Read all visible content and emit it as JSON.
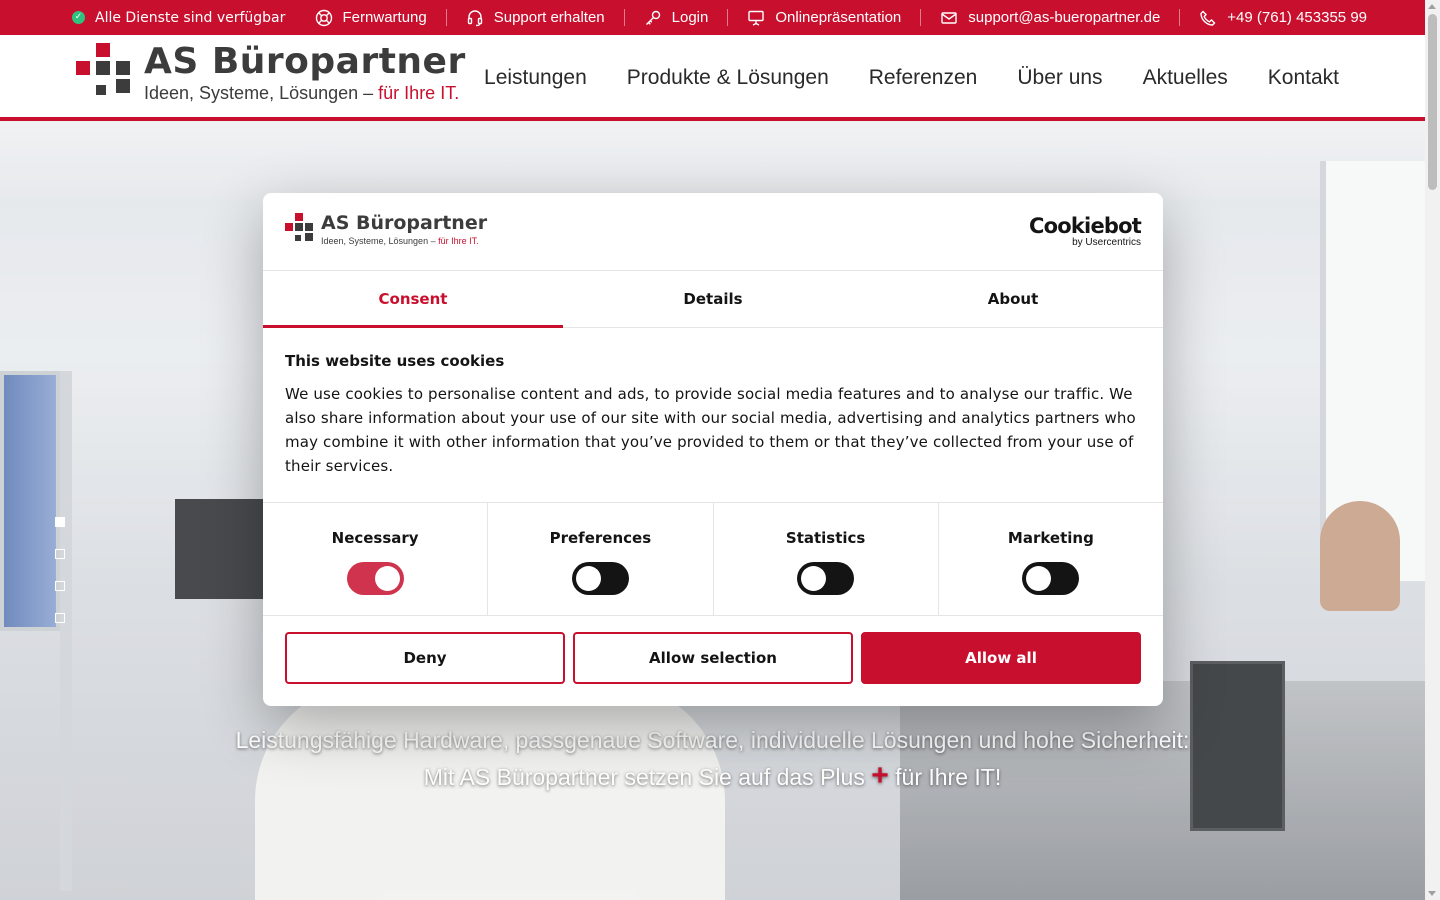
{
  "topbar": {
    "status_text": "Alle Dienste sind verfügbar",
    "links": [
      {
        "label": "Fernwartung",
        "icon": "lifebuoy-icon"
      },
      {
        "label": "Support erhalten",
        "icon": "headset-icon"
      },
      {
        "label": "Login",
        "icon": "key-icon"
      },
      {
        "label": "Onlinepräsentation",
        "icon": "presentation-icon"
      },
      {
        "label": "support@as-bueropartner.de",
        "icon": "envelope-icon"
      },
      {
        "label": "+49 (761) 453355 99",
        "icon": "phone-icon"
      }
    ]
  },
  "header": {
    "logo_name": "AS Büropartner",
    "logo_tagline": "Ideen, Systeme, Lösungen – ",
    "logo_tagline_accent": "für Ihre IT.",
    "nav": [
      "Leistungen",
      "Produkte & Lösungen",
      "Referenzen",
      "Über uns",
      "Aktuelles",
      "Kontakt"
    ]
  },
  "hero": {
    "line1": "Leistungsfähige Hardware, passgenaue Software, individuelle Lösungen und hohe Sicherheit:",
    "line2_a": "Mit AS Büropartner setzen Sie auf das Plus ",
    "line2_plus": "+",
    "line2_b": " für Ihre IT!",
    "slides_count": 4,
    "active_slide": 1
  },
  "cookie_dialog": {
    "logo_name": "AS Büropartner",
    "logo_tagline": "Ideen, Systeme, Lösungen – ",
    "logo_tagline_accent": "für Ihre IT.",
    "provider": "Cookiebot",
    "provider_sub": "by Usercentrics",
    "tabs": [
      "Consent",
      "Details",
      "About"
    ],
    "active_tab": "Consent",
    "heading": "This website uses cookies",
    "body": "We use cookies to personalise content and ads, to provide social media features and to analyse our traffic. We also share information about your use of our site with our social media, advertising and analytics partners who may combine it with other information that you’ve provided to them or that they’ve collected from your use of their services.",
    "toggles": [
      {
        "label": "Necessary",
        "on": true
      },
      {
        "label": "Preferences",
        "on": false
      },
      {
        "label": "Statistics",
        "on": false
      },
      {
        "label": "Marketing",
        "on": false
      }
    ],
    "buttons": {
      "deny": "Deny",
      "allow_selection": "Allow selection",
      "allow_all": "Allow all"
    }
  },
  "colors": {
    "brand_red": "#c8102e",
    "status_green": "#2ec27e",
    "text_dark": "#141414"
  }
}
